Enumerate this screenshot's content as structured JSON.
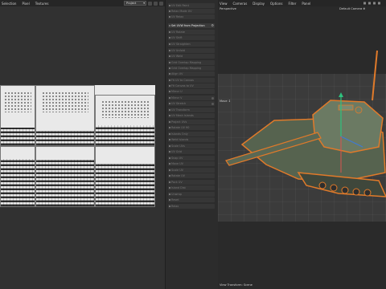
{
  "uv_editor": {
    "menu": [
      "Selection",
      "Pixel",
      "Textures"
    ],
    "project_select": "Project"
  },
  "tools_panel": {
    "items": [
      {
        "label": "UV Edit Paint",
        "active": false
      },
      {
        "label": "Relax Mode UV",
        "active": false
      },
      {
        "label": "UV Relax",
        "active": false
      },
      {
        "label": "Set UVW from Projection",
        "active": true
      },
      {
        "label": "UV Rotate",
        "active": false
      },
      {
        "label": "UV Shift",
        "active": false
      },
      {
        "label": "UV Straighten",
        "active": false
      },
      {
        "label": "UV Unfold",
        "active": false
      },
      {
        "label": "UV Weld",
        "active": false
      },
      {
        "label": "Grid Overlap Mapping",
        "active": false
      },
      {
        "label": "Grid Overlap Mapping",
        "active": false
      },
      {
        "label": "Align UV",
        "active": false
      },
      {
        "label": "Fit UV to Canvas",
        "active": false
      },
      {
        "label": "Fit Canvas to UV",
        "active": false
      },
      {
        "label": "Mirror U",
        "active": false
      },
      {
        "label": "Mirror V",
        "active": false
      },
      {
        "label": "UV Stretch",
        "active": false
      },
      {
        "label": "UV Transform",
        "active": false
      },
      {
        "label": "UV Mesh Islands",
        "active": false
      },
      {
        "label": "Project UVs",
        "active": false
      },
      {
        "label": "Rotate UV 90",
        "active": false
      },
      {
        "label": "Islands Only",
        "active": false
      },
      {
        "label": "Weld Islands",
        "active": false
      },
      {
        "label": "Scale UVs",
        "active": false
      },
      {
        "label": "UV Grid",
        "active": false
      },
      {
        "label": "Snap UV",
        "active": false
      },
      {
        "label": "Move UV",
        "active": false
      },
      {
        "label": "Scale UV",
        "active": false
      },
      {
        "label": "Rotate UV",
        "active": false
      },
      {
        "label": "Pack UV",
        "active": false
      },
      {
        "label": "Island Dist",
        "active": false
      },
      {
        "label": "Unwrap",
        "active": false
      },
      {
        "label": "Reset",
        "active": false
      },
      {
        "label": "Relax",
        "active": false
      }
    ]
  },
  "viewport": {
    "menu": [
      "View",
      "Cameras",
      "Display",
      "Options",
      "Filter",
      "Panel"
    ],
    "view_name": "Perspective",
    "camera": "Default Camera",
    "move_label": "Move",
    "status": "View Transform: Scene"
  },
  "colors": {
    "accent_orange": "#e07a2a",
    "tank_green": "#5f6d5a",
    "axis_y": "#2ec27e",
    "axis_z": "#3d7ad6",
    "axis_x": "#d9534f"
  }
}
